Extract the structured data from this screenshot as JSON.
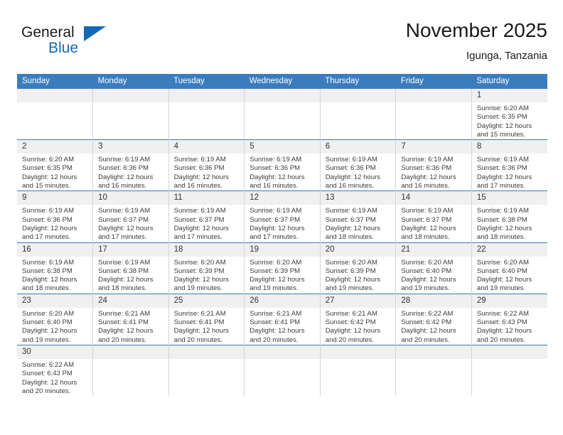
{
  "brand": {
    "name_top": "General",
    "name_bottom": "Blue",
    "accent_color": "#1569b4"
  },
  "header": {
    "title": "November 2025",
    "subtitle": "Igunga, Tanzania"
  },
  "theme": {
    "header_row_bg": "#3a7cbe",
    "daynum_bg": "#f0f0f0",
    "row_divider": "#3a7cbe",
    "cell_divider": "#d4d4d4"
  },
  "weekday_headers": [
    "Sunday",
    "Monday",
    "Tuesday",
    "Wednesday",
    "Thursday",
    "Friday",
    "Saturday"
  ],
  "weeks": [
    [
      {
        "day": "",
        "lines": [
          "",
          "",
          "",
          ""
        ],
        "empty": true
      },
      {
        "day": "",
        "lines": [
          "",
          "",
          "",
          ""
        ],
        "empty": true
      },
      {
        "day": "",
        "lines": [
          "",
          "",
          "",
          ""
        ],
        "empty": true
      },
      {
        "day": "",
        "lines": [
          "",
          "",
          "",
          ""
        ],
        "empty": true
      },
      {
        "day": "",
        "lines": [
          "",
          "",
          "",
          ""
        ],
        "empty": true
      },
      {
        "day": "",
        "lines": [
          "",
          "",
          "",
          ""
        ],
        "empty": true
      },
      {
        "day": "1",
        "lines": [
          "Sunrise: 6:20 AM",
          "Sunset: 6:35 PM",
          "Daylight: 12 hours",
          "and 15 minutes."
        ],
        "empty": false
      }
    ],
    [
      {
        "day": "2",
        "lines": [
          "Sunrise: 6:20 AM",
          "Sunset: 6:35 PM",
          "Daylight: 12 hours",
          "and 15 minutes."
        ],
        "empty": false
      },
      {
        "day": "3",
        "lines": [
          "Sunrise: 6:19 AM",
          "Sunset: 6:36 PM",
          "Daylight: 12 hours",
          "and 16 minutes."
        ],
        "empty": false
      },
      {
        "day": "4",
        "lines": [
          "Sunrise: 6:19 AM",
          "Sunset: 6:36 PM",
          "Daylight: 12 hours",
          "and 16 minutes."
        ],
        "empty": false
      },
      {
        "day": "5",
        "lines": [
          "Sunrise: 6:19 AM",
          "Sunset: 6:36 PM",
          "Daylight: 12 hours",
          "and 16 minutes."
        ],
        "empty": false
      },
      {
        "day": "6",
        "lines": [
          "Sunrise: 6:19 AM",
          "Sunset: 6:36 PM",
          "Daylight: 12 hours",
          "and 16 minutes."
        ],
        "empty": false
      },
      {
        "day": "7",
        "lines": [
          "Sunrise: 6:19 AM",
          "Sunset: 6:36 PM",
          "Daylight: 12 hours",
          "and 16 minutes."
        ],
        "empty": false
      },
      {
        "day": "8",
        "lines": [
          "Sunrise: 6:19 AM",
          "Sunset: 6:36 PM",
          "Daylight: 12 hours",
          "and 17 minutes."
        ],
        "empty": false
      }
    ],
    [
      {
        "day": "9",
        "lines": [
          "Sunrise: 6:19 AM",
          "Sunset: 6:36 PM",
          "Daylight: 12 hours",
          "and 17 minutes."
        ],
        "empty": false
      },
      {
        "day": "10",
        "lines": [
          "Sunrise: 6:19 AM",
          "Sunset: 6:37 PM",
          "Daylight: 12 hours",
          "and 17 minutes."
        ],
        "empty": false
      },
      {
        "day": "11",
        "lines": [
          "Sunrise: 6:19 AM",
          "Sunset: 6:37 PM",
          "Daylight: 12 hours",
          "and 17 minutes."
        ],
        "empty": false
      },
      {
        "day": "12",
        "lines": [
          "Sunrise: 6:19 AM",
          "Sunset: 6:37 PM",
          "Daylight: 12 hours",
          "and 17 minutes."
        ],
        "empty": false
      },
      {
        "day": "13",
        "lines": [
          "Sunrise: 6:19 AM",
          "Sunset: 6:37 PM",
          "Daylight: 12 hours",
          "and 18 minutes."
        ],
        "empty": false
      },
      {
        "day": "14",
        "lines": [
          "Sunrise: 6:19 AM",
          "Sunset: 6:37 PM",
          "Daylight: 12 hours",
          "and 18 minutes."
        ],
        "empty": false
      },
      {
        "day": "15",
        "lines": [
          "Sunrise: 6:19 AM",
          "Sunset: 6:38 PM",
          "Daylight: 12 hours",
          "and 18 minutes."
        ],
        "empty": false
      }
    ],
    [
      {
        "day": "16",
        "lines": [
          "Sunrise: 6:19 AM",
          "Sunset: 6:38 PM",
          "Daylight: 12 hours",
          "and 18 minutes."
        ],
        "empty": false
      },
      {
        "day": "17",
        "lines": [
          "Sunrise: 6:19 AM",
          "Sunset: 6:38 PM",
          "Daylight: 12 hours",
          "and 18 minutes."
        ],
        "empty": false
      },
      {
        "day": "18",
        "lines": [
          "Sunrise: 6:20 AM",
          "Sunset: 6:39 PM",
          "Daylight: 12 hours",
          "and 19 minutes."
        ],
        "empty": false
      },
      {
        "day": "19",
        "lines": [
          "Sunrise: 6:20 AM",
          "Sunset: 6:39 PM",
          "Daylight: 12 hours",
          "and 19 minutes."
        ],
        "empty": false
      },
      {
        "day": "20",
        "lines": [
          "Sunrise: 6:20 AM",
          "Sunset: 6:39 PM",
          "Daylight: 12 hours",
          "and 19 minutes."
        ],
        "empty": false
      },
      {
        "day": "21",
        "lines": [
          "Sunrise: 6:20 AM",
          "Sunset: 6:40 PM",
          "Daylight: 12 hours",
          "and 19 minutes."
        ],
        "empty": false
      },
      {
        "day": "22",
        "lines": [
          "Sunrise: 6:20 AM",
          "Sunset: 6:40 PM",
          "Daylight: 12 hours",
          "and 19 minutes."
        ],
        "empty": false
      }
    ],
    [
      {
        "day": "23",
        "lines": [
          "Sunrise: 6:20 AM",
          "Sunset: 6:40 PM",
          "Daylight: 12 hours",
          "and 19 minutes."
        ],
        "empty": false
      },
      {
        "day": "24",
        "lines": [
          "Sunrise: 6:21 AM",
          "Sunset: 6:41 PM",
          "Daylight: 12 hours",
          "and 20 minutes."
        ],
        "empty": false
      },
      {
        "day": "25",
        "lines": [
          "Sunrise: 6:21 AM",
          "Sunset: 6:41 PM",
          "Daylight: 12 hours",
          "and 20 minutes."
        ],
        "empty": false
      },
      {
        "day": "26",
        "lines": [
          "Sunrise: 6:21 AM",
          "Sunset: 6:41 PM",
          "Daylight: 12 hours",
          "and 20 minutes."
        ],
        "empty": false
      },
      {
        "day": "27",
        "lines": [
          "Sunrise: 6:21 AM",
          "Sunset: 6:42 PM",
          "Daylight: 12 hours",
          "and 20 minutes."
        ],
        "empty": false
      },
      {
        "day": "28",
        "lines": [
          "Sunrise: 6:22 AM",
          "Sunset: 6:42 PM",
          "Daylight: 12 hours",
          "and 20 minutes."
        ],
        "empty": false
      },
      {
        "day": "29",
        "lines": [
          "Sunrise: 6:22 AM",
          "Sunset: 6:43 PM",
          "Daylight: 12 hours",
          "and 20 minutes."
        ],
        "empty": false
      }
    ],
    [
      {
        "day": "30",
        "lines": [
          "Sunrise: 6:22 AM",
          "Sunset: 6:43 PM",
          "Daylight: 12 hours",
          "and 20 minutes."
        ],
        "empty": false
      },
      {
        "day": "",
        "lines": [
          "",
          "",
          "",
          ""
        ],
        "empty": true
      },
      {
        "day": "",
        "lines": [
          "",
          "",
          "",
          ""
        ],
        "empty": true
      },
      {
        "day": "",
        "lines": [
          "",
          "",
          "",
          ""
        ],
        "empty": true
      },
      {
        "day": "",
        "lines": [
          "",
          "",
          "",
          ""
        ],
        "empty": true
      },
      {
        "day": "",
        "lines": [
          "",
          "",
          "",
          ""
        ],
        "empty": true
      },
      {
        "day": "",
        "lines": [
          "",
          "",
          "",
          ""
        ],
        "empty": true
      }
    ]
  ]
}
